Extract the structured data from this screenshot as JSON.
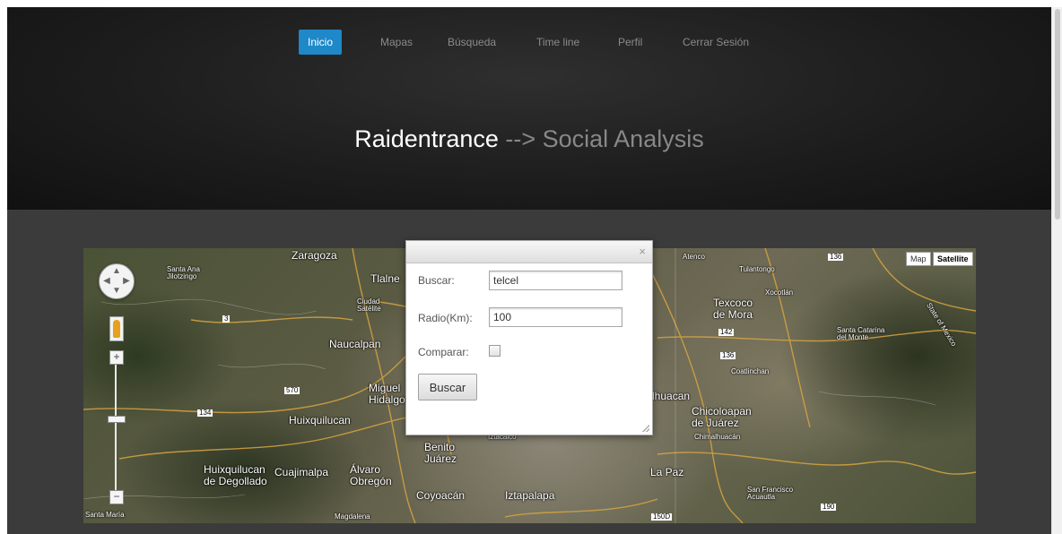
{
  "nav": {
    "items": [
      {
        "label": "Inicio",
        "active": true
      },
      {
        "label": "Mapas",
        "active": false
      },
      {
        "label": "Búsqueda",
        "active": false
      },
      {
        "label": "Time line",
        "active": false
      },
      {
        "label": "Perfil",
        "active": false
      },
      {
        "label": "Cerrar Sesión",
        "active": false
      }
    ]
  },
  "header": {
    "title_main": "Raidentrance",
    "title_sub": " --> Social Analysis"
  },
  "map": {
    "type_buttons": {
      "map": "Map",
      "satellite": "Satellite",
      "selected": "Satellite"
    },
    "zoom": {
      "plus": "+",
      "minus": "−"
    },
    "labels": {
      "zaragoza": "Zaragoza",
      "santa_ana": "Santa Ana\nJilotzingo",
      "tlalne": "Tlalne",
      "ciudad_satelite": "Ciudad\nSatélite",
      "naucalpan": "Naucalpan",
      "miguel_hidalgo": "Miguel\nHidalgo",
      "huixquilucan": "Huixquilucan",
      "huixquilucan_degollado": "Huixquilucan\nde Degollado",
      "cuajimalpa": "Cuajimalpa",
      "alvaro_obregon": "Álvaro\nObregón",
      "benito_juarez": "Benito\nJuárez",
      "coyoacan": "Coyoacán",
      "iztapalapa": "Iztapalapa",
      "iztacalco": "Iztacalco",
      "magdalena": "Magdalena",
      "santa_maria": "Santa María",
      "atenco": "Atenco",
      "tulantongo": "Tulantongo",
      "xocotlan": "Xocotlán",
      "texcoco": "Texcoco\nde Mora",
      "santa_catarina": "Santa Catarina\ndel Monte",
      "state_mexico": "State of Mexico",
      "coatlinchan": "Coatlinchan",
      "ilhuacan": "lhuacan",
      "chicoloapan": "Chicoloapan\nde Juárez",
      "chimalhuacan": "Chimalhuacán",
      "la_paz": "La Paz",
      "san_francisco": "San Francisco\nAcuautla",
      "shield_3": "3",
      "shield_570": "570",
      "shield_134": "134",
      "shield_136a": "136",
      "shield_136b": "136",
      "shield_142": "142",
      "shield_190": "190",
      "shield_150d": "150D"
    }
  },
  "dialog": {
    "close_label": "×",
    "buscar_label": "Buscar:",
    "buscar_value": "telcel",
    "radio_label": "Radio(Km):",
    "radio_value": "100",
    "comparar_label": "Comparar:",
    "comparar_checked": false,
    "submit_label": "Buscar"
  }
}
